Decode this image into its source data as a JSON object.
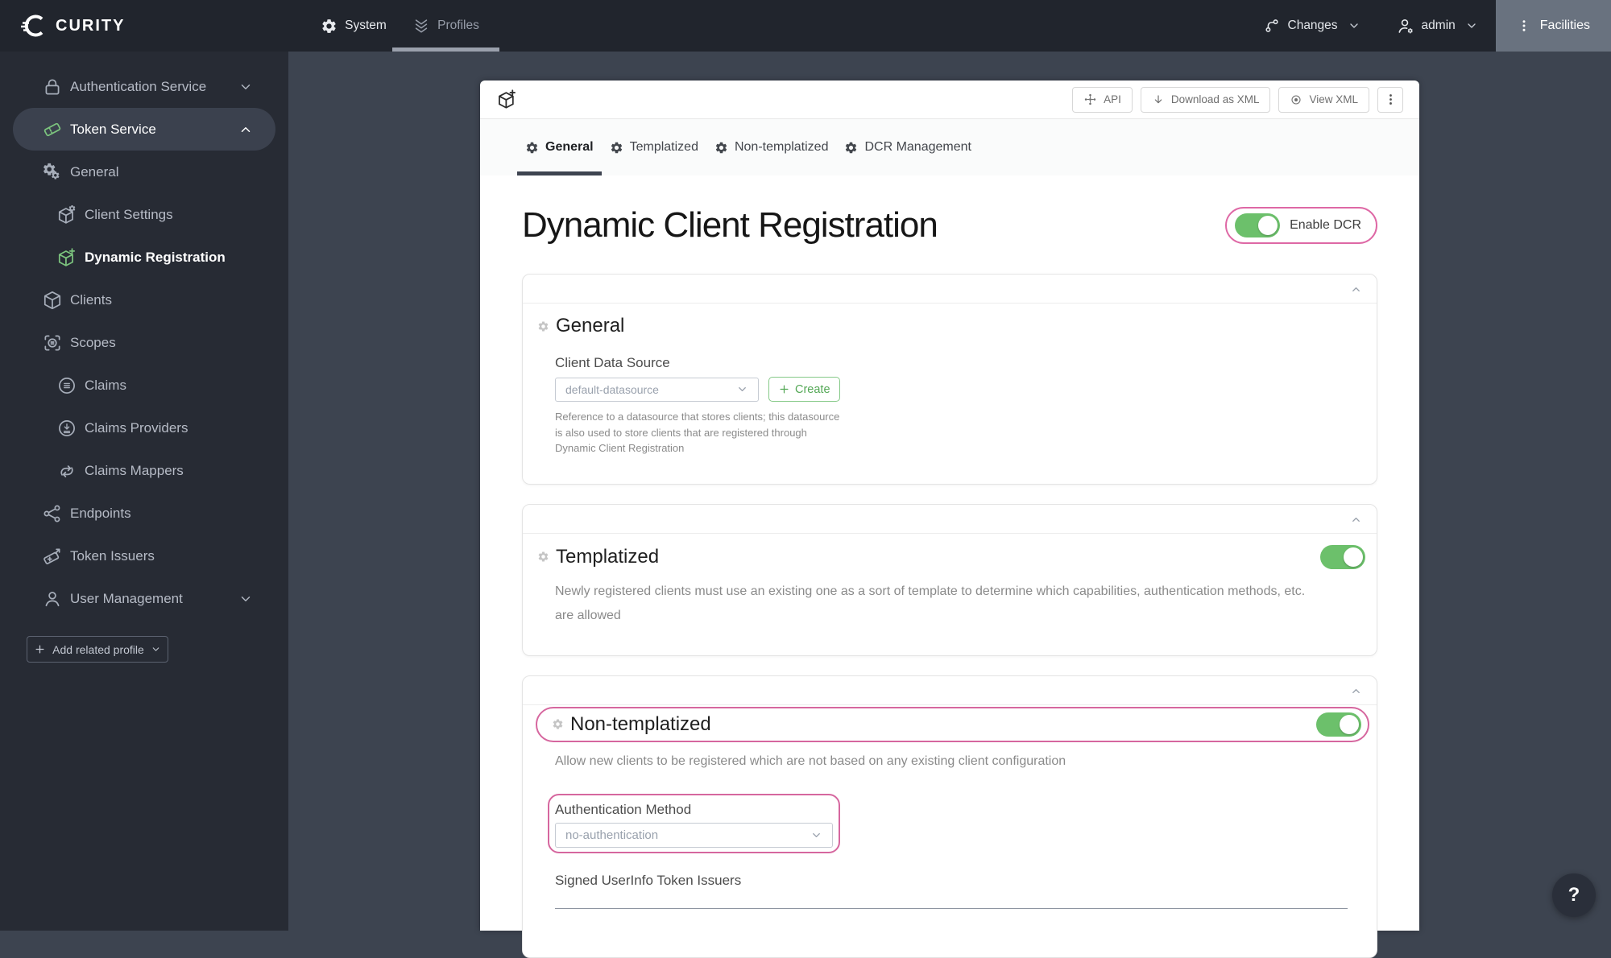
{
  "nav": {
    "brand": "CURITY",
    "system_label": "System",
    "profiles_label": "Profiles",
    "changes_label": "Changes",
    "user_label": "admin",
    "facilities_label": "Facilities"
  },
  "sidebar": {
    "items": [
      {
        "label": "Authentication Service"
      },
      {
        "label": "Token Service"
      },
      {
        "label": "General"
      },
      {
        "label": "Client Settings"
      },
      {
        "label": "Dynamic Registration"
      },
      {
        "label": "Clients"
      },
      {
        "label": "Scopes"
      },
      {
        "label": "Claims"
      },
      {
        "label": "Claims Providers"
      },
      {
        "label": "Claims Mappers"
      },
      {
        "label": "Endpoints"
      },
      {
        "label": "Token Issuers"
      },
      {
        "label": "User Management"
      }
    ],
    "add_related_profile": "Add related profile"
  },
  "toolbar": {
    "api_label": "API",
    "download_label": "Download as XML",
    "view_label": "View XML"
  },
  "tabs": [
    {
      "label": "General"
    },
    {
      "label": "Templatized"
    },
    {
      "label": "Non-templatized"
    },
    {
      "label": "DCR Management"
    }
  ],
  "page": {
    "title": "Dynamic Client Registration",
    "enable_dcr_label": "Enable DCR"
  },
  "sections": {
    "general": {
      "title": "General",
      "client_data_source_label": "Client Data Source",
      "datasource_value": "default-datasource",
      "create_label": "Create",
      "description_lines": [
        "Reference to a datasource that stores clients; this datasource",
        "is also used to store clients that are registered through",
        "Dynamic Client Registration"
      ]
    },
    "templatized": {
      "title": "Templatized",
      "description_lines": [
        "Newly registered clients must use an existing one as a sort of template to determine which capabilities, authentication methods, etc.",
        "are allowed"
      ]
    },
    "non_templatized": {
      "title": "Non-templatized",
      "description": "Allow new clients to be registered which are not based on any existing client configuration",
      "auth_method_label": "Authentication Method",
      "auth_method_value": "no-authentication",
      "signed_userinfo_label": "Signed UserInfo Token Issuers"
    }
  },
  "help": {
    "label": "?"
  },
  "colors": {
    "accent_green": "#6cc06b",
    "accent_pink": "#d6679f",
    "nav_bg": "#21252d",
    "sidebar_bg": "#272b34",
    "main_bg": "#3d4450"
  }
}
